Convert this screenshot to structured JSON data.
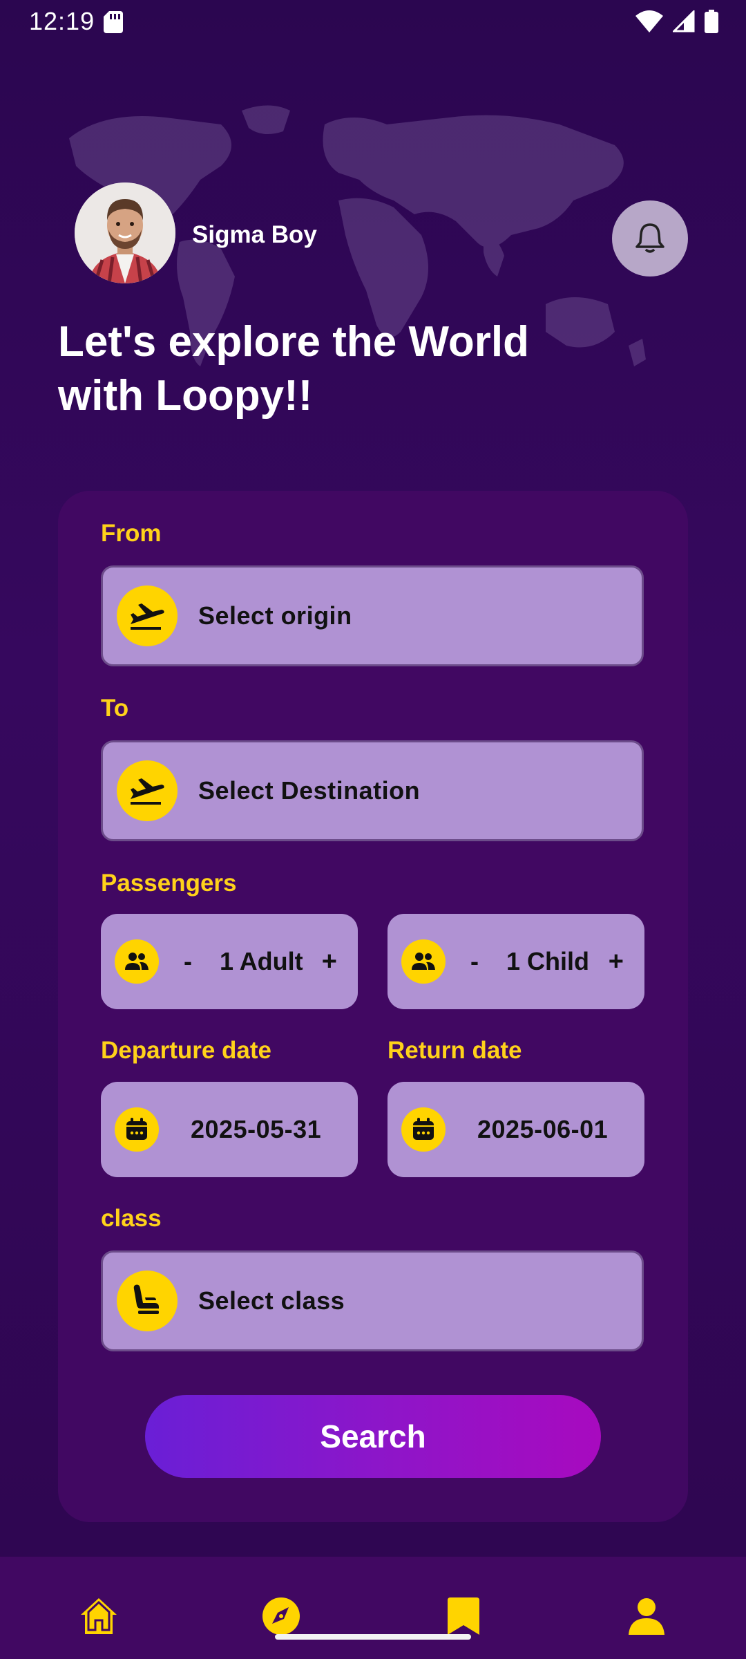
{
  "status_bar": {
    "time": "12:19",
    "icons": [
      "sd-card-icon",
      "wifi-icon",
      "signal-icon",
      "battery-icon"
    ]
  },
  "header": {
    "user_name": "Sigma Boy",
    "avatar_icon": "avatar",
    "notification_icon": "bell-icon",
    "headline": "Let's explore the World with Loopy!!"
  },
  "form": {
    "from": {
      "label": "From",
      "placeholder": "Select origin",
      "icon": "airplane-icon"
    },
    "to": {
      "label": "To",
      "placeholder": "Select Destination",
      "icon": "airplane-icon"
    },
    "passengers": {
      "label": "Passengers",
      "adult": {
        "minus": "-",
        "value": "1 Adult",
        "plus": "+",
        "icon": "people-icon"
      },
      "child": {
        "minus": "-",
        "value": "1 Child",
        "plus": "+",
        "icon": "people-icon"
      }
    },
    "departure": {
      "label": "Departure date",
      "value": "2025-05-31",
      "icon": "calendar-icon"
    },
    "return": {
      "label": "Return date",
      "value": "2025-06-01",
      "icon": "calendar-icon"
    },
    "class": {
      "label": "class",
      "placeholder": "Select class",
      "icon": "seat-icon"
    },
    "search_label": "Search"
  },
  "bottom_nav": {
    "items": [
      {
        "icon": "home-icon"
      },
      {
        "icon": "compass-icon"
      },
      {
        "icon": "bookmark-icon"
      },
      {
        "icon": "user-icon"
      }
    ]
  },
  "colors": {
    "background": "#2e0650",
    "card": "#410862",
    "accent_yellow": "#ffd21a",
    "field": "#b092d3",
    "button_gradient_start": "#6a1fd6",
    "button_gradient_end": "#a80abf"
  }
}
